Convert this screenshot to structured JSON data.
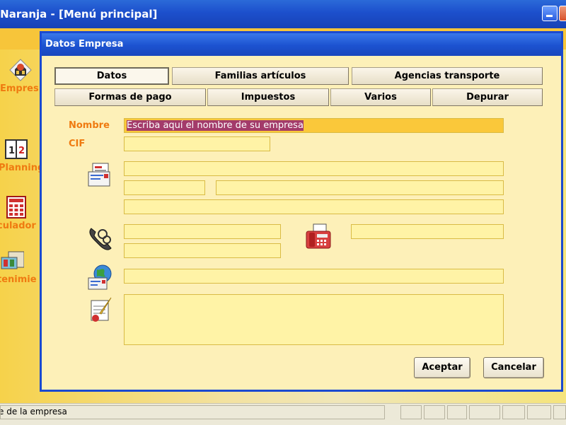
{
  "window": {
    "title": "s Naranja - [Menú principal]"
  },
  "sidebar": {
    "items": [
      {
        "label": "Empres",
        "icon": "company-icon"
      },
      {
        "label": "Planning",
        "icon": "calendar-icon"
      },
      {
        "label": "culador",
        "icon": "calculator-icon"
      },
      {
        "label": "tenimie",
        "icon": "maintenance-icon"
      }
    ]
  },
  "dialog": {
    "title": "Datos Empresa",
    "tabs_row1": [
      "Datos",
      "Familias artículos",
      "Agencias transporte"
    ],
    "tabs_row2": [
      "Formas de pago",
      "Impuestos",
      "Varios",
      "Depurar"
    ],
    "active_tab": "Datos",
    "fields": {
      "nombre_label": "Nombre",
      "nombre_value": "Escriba aquí el nombre de su empresa",
      "cif_label": "CIF"
    },
    "icons": {
      "address": "address-card-icon",
      "contacts": "phone-handset-icon",
      "fax": "fax-icon",
      "web": "globe-mail-icon",
      "notes": "notes-quill-icon"
    },
    "buttons": {
      "accept": "Aceptar",
      "cancel": "Cancelar"
    }
  },
  "statusbar": {
    "text": "e de la empresa"
  },
  "colors": {
    "accent_blue": "#1c52d0",
    "label_orange": "#ef7a10",
    "field_yellow": "#fff3a6",
    "dialog_bg": "#fdf0b8"
  }
}
